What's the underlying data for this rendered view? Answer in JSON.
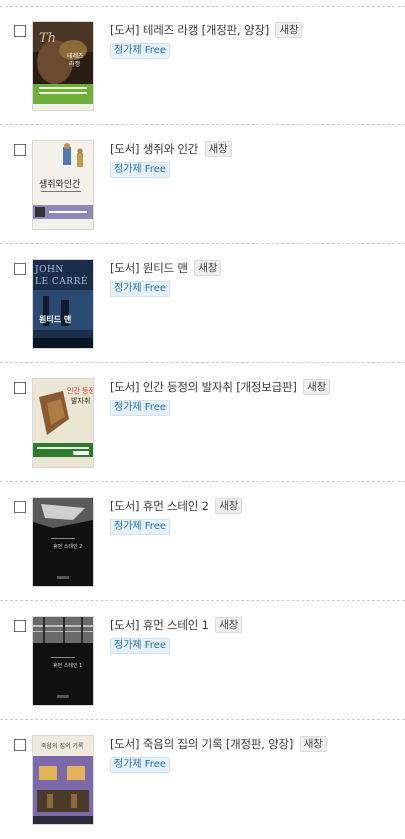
{
  "new_window_label": "새창",
  "free_badge_label": "정가제 Free",
  "items": [
    {
      "category": "[도서]",
      "title": "테레즈 라캥 [개정판, 양장]",
      "cover": {
        "title_text": "테레즈 라캥",
        "bg": "#2a1d14",
        "band": "#6fae3a"
      }
    },
    {
      "category": "[도서]",
      "title": "생쥐와 인간",
      "cover": {
        "title_text": "생쥐와 인간",
        "bg": "#f2efe8",
        "band": "#8f86b8"
      }
    },
    {
      "category": "[도서]",
      "title": "원티드 맨",
      "cover": {
        "title_text": "원티드 맨",
        "bg": "#1b2d48",
        "author_text": "JOHN LE CARRÉ"
      }
    },
    {
      "category": "[도서]",
      "title": "인간 등정의 발자취 [개정보급판]",
      "cover": {
        "title_text": "인간 등정의 발자취",
        "bg": "#e9e2cf",
        "band": "#2f7a2e"
      }
    },
    {
      "category": "[도서]",
      "title": "휴먼 스테인 2",
      "cover": {
        "title_text": "휴먼 스테인 2",
        "bg": "#101010"
      }
    },
    {
      "category": "[도서]",
      "title": "휴먼 스테인 1",
      "cover": {
        "title_text": "휴먼 스테인 1",
        "bg": "#101010"
      }
    },
    {
      "category": "[도서]",
      "title": "죽음의 집의 기록 [개정판, 양장]",
      "cover": {
        "title_text": "죽음의 집의 기록",
        "bg": "#efe9de",
        "band": "#7a6aa8"
      }
    }
  ]
}
